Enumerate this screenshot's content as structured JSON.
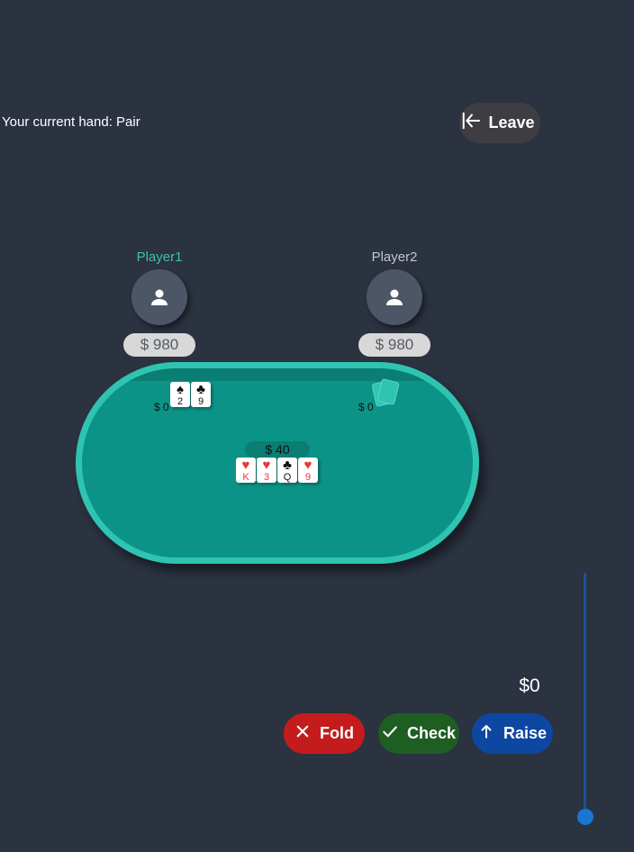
{
  "hand_label": "Your current hand: Pair",
  "leave_label": "Leave",
  "players": [
    {
      "name": "Player1",
      "stack": "$ 980",
      "bet": "$ 0",
      "cards": [
        {
          "suit": "♠",
          "rank": "2",
          "color": "black"
        },
        {
          "suit": "♣",
          "rank": "9",
          "color": "black"
        }
      ]
    },
    {
      "name": "Player2",
      "stack": "$ 980",
      "bet": "$ 0"
    }
  ],
  "pot": "$ 40",
  "community_cards": [
    {
      "suit": "♥",
      "rank": "K",
      "color": "red"
    },
    {
      "suit": "♥",
      "rank": "3",
      "color": "red"
    },
    {
      "suit": "♣",
      "rank": "Q",
      "color": "black"
    },
    {
      "suit": "♥",
      "rank": "9",
      "color": "red"
    }
  ],
  "raise_amount": "$0",
  "raise_slider_value": 0,
  "actions": {
    "fold": "Fold",
    "check": "Check",
    "raise": "Raise"
  },
  "colors": {
    "background": "#2b3240",
    "table_felt": "#0c9387",
    "table_rail": "#2fc4b2",
    "fold": "#c41c1c",
    "check": "#1e5e23",
    "raise": "#0d47a1",
    "leave": "#3d3d42"
  },
  "icons": {
    "leave": "arrow-left-to-bar-icon",
    "avatar": "person-icon",
    "fold": "close-icon",
    "check": "checkmark-icon",
    "raise": "arrow-up-icon"
  }
}
